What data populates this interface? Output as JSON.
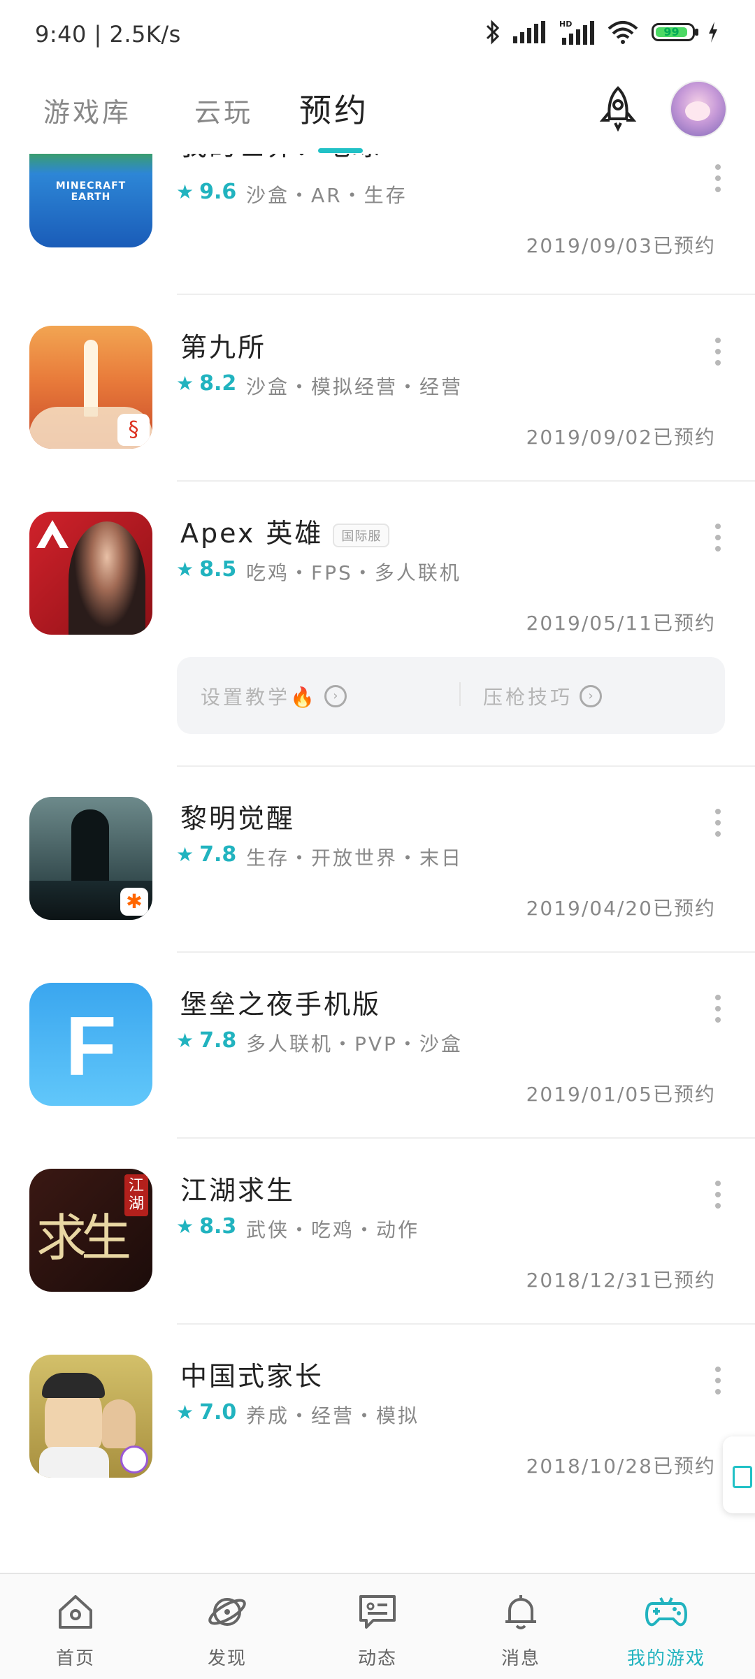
{
  "status_bar": {
    "time_speed": "9:40 | 2.5K/s",
    "battery": "99"
  },
  "header": {
    "tabs": [
      {
        "label": "游戏库",
        "active": false
      },
      {
        "label": "云玩",
        "active": false
      },
      {
        "label": "预约",
        "active": true
      }
    ]
  },
  "games": [
    {
      "title": "我的世界：地球",
      "rating": "9.6",
      "tags": "沙盒・AR・生存",
      "date": "2019/09/03已预约",
      "icon": "minecraft-earth-icon",
      "icon_text": "MINECRAFT EARTH"
    },
    {
      "title": "第九所",
      "rating": "8.2",
      "tags": "沙盒・模拟经营・经营",
      "date": "2019/09/02已预约",
      "icon": "rocket-launch-icon"
    },
    {
      "title": "Apex 英雄",
      "badge": "国际服",
      "rating": "8.5",
      "tags": "吃鸡・FPS・多人联机",
      "date": "2019/05/11已预约",
      "icon": "apex-legends-icon",
      "quick_links": [
        {
          "label": "设置教学🔥"
        },
        {
          "label": "压枪技巧"
        }
      ]
    },
    {
      "title": "黎明觉醒",
      "rating": "7.8",
      "tags": "生存・开放世界・末日",
      "date": "2019/04/20已预约",
      "icon": "dawn-awakening-icon"
    },
    {
      "title": "堡垒之夜手机版",
      "rating": "7.8",
      "tags": "多人联机・PVP・沙盒",
      "date": "2019/01/05已预约",
      "icon": "fortnite-icon",
      "icon_text": "F"
    },
    {
      "title": "江湖求生",
      "rating": "8.3",
      "tags": "武侠・吃鸡・动作",
      "date": "2018/12/31已预约",
      "icon": "jianghu-icon",
      "icon_text": "求生",
      "icon_small": "江湖"
    },
    {
      "title": "中国式家长",
      "rating": "7.0",
      "tags": "养成・经营・模拟",
      "date": "2018/10/28已预约",
      "icon": "chinese-parents-icon"
    }
  ],
  "bottom_nav": [
    {
      "label": "首页",
      "icon": "home-icon"
    },
    {
      "label": "发现",
      "icon": "planet-icon"
    },
    {
      "label": "动态",
      "icon": "chat-icon"
    },
    {
      "label": "消息",
      "icon": "bell-icon"
    },
    {
      "label": "我的游戏",
      "icon": "gamepad-icon",
      "active": true
    }
  ],
  "colors": {
    "accent": "#21b3bf",
    "indicator": "#21c1c6"
  }
}
